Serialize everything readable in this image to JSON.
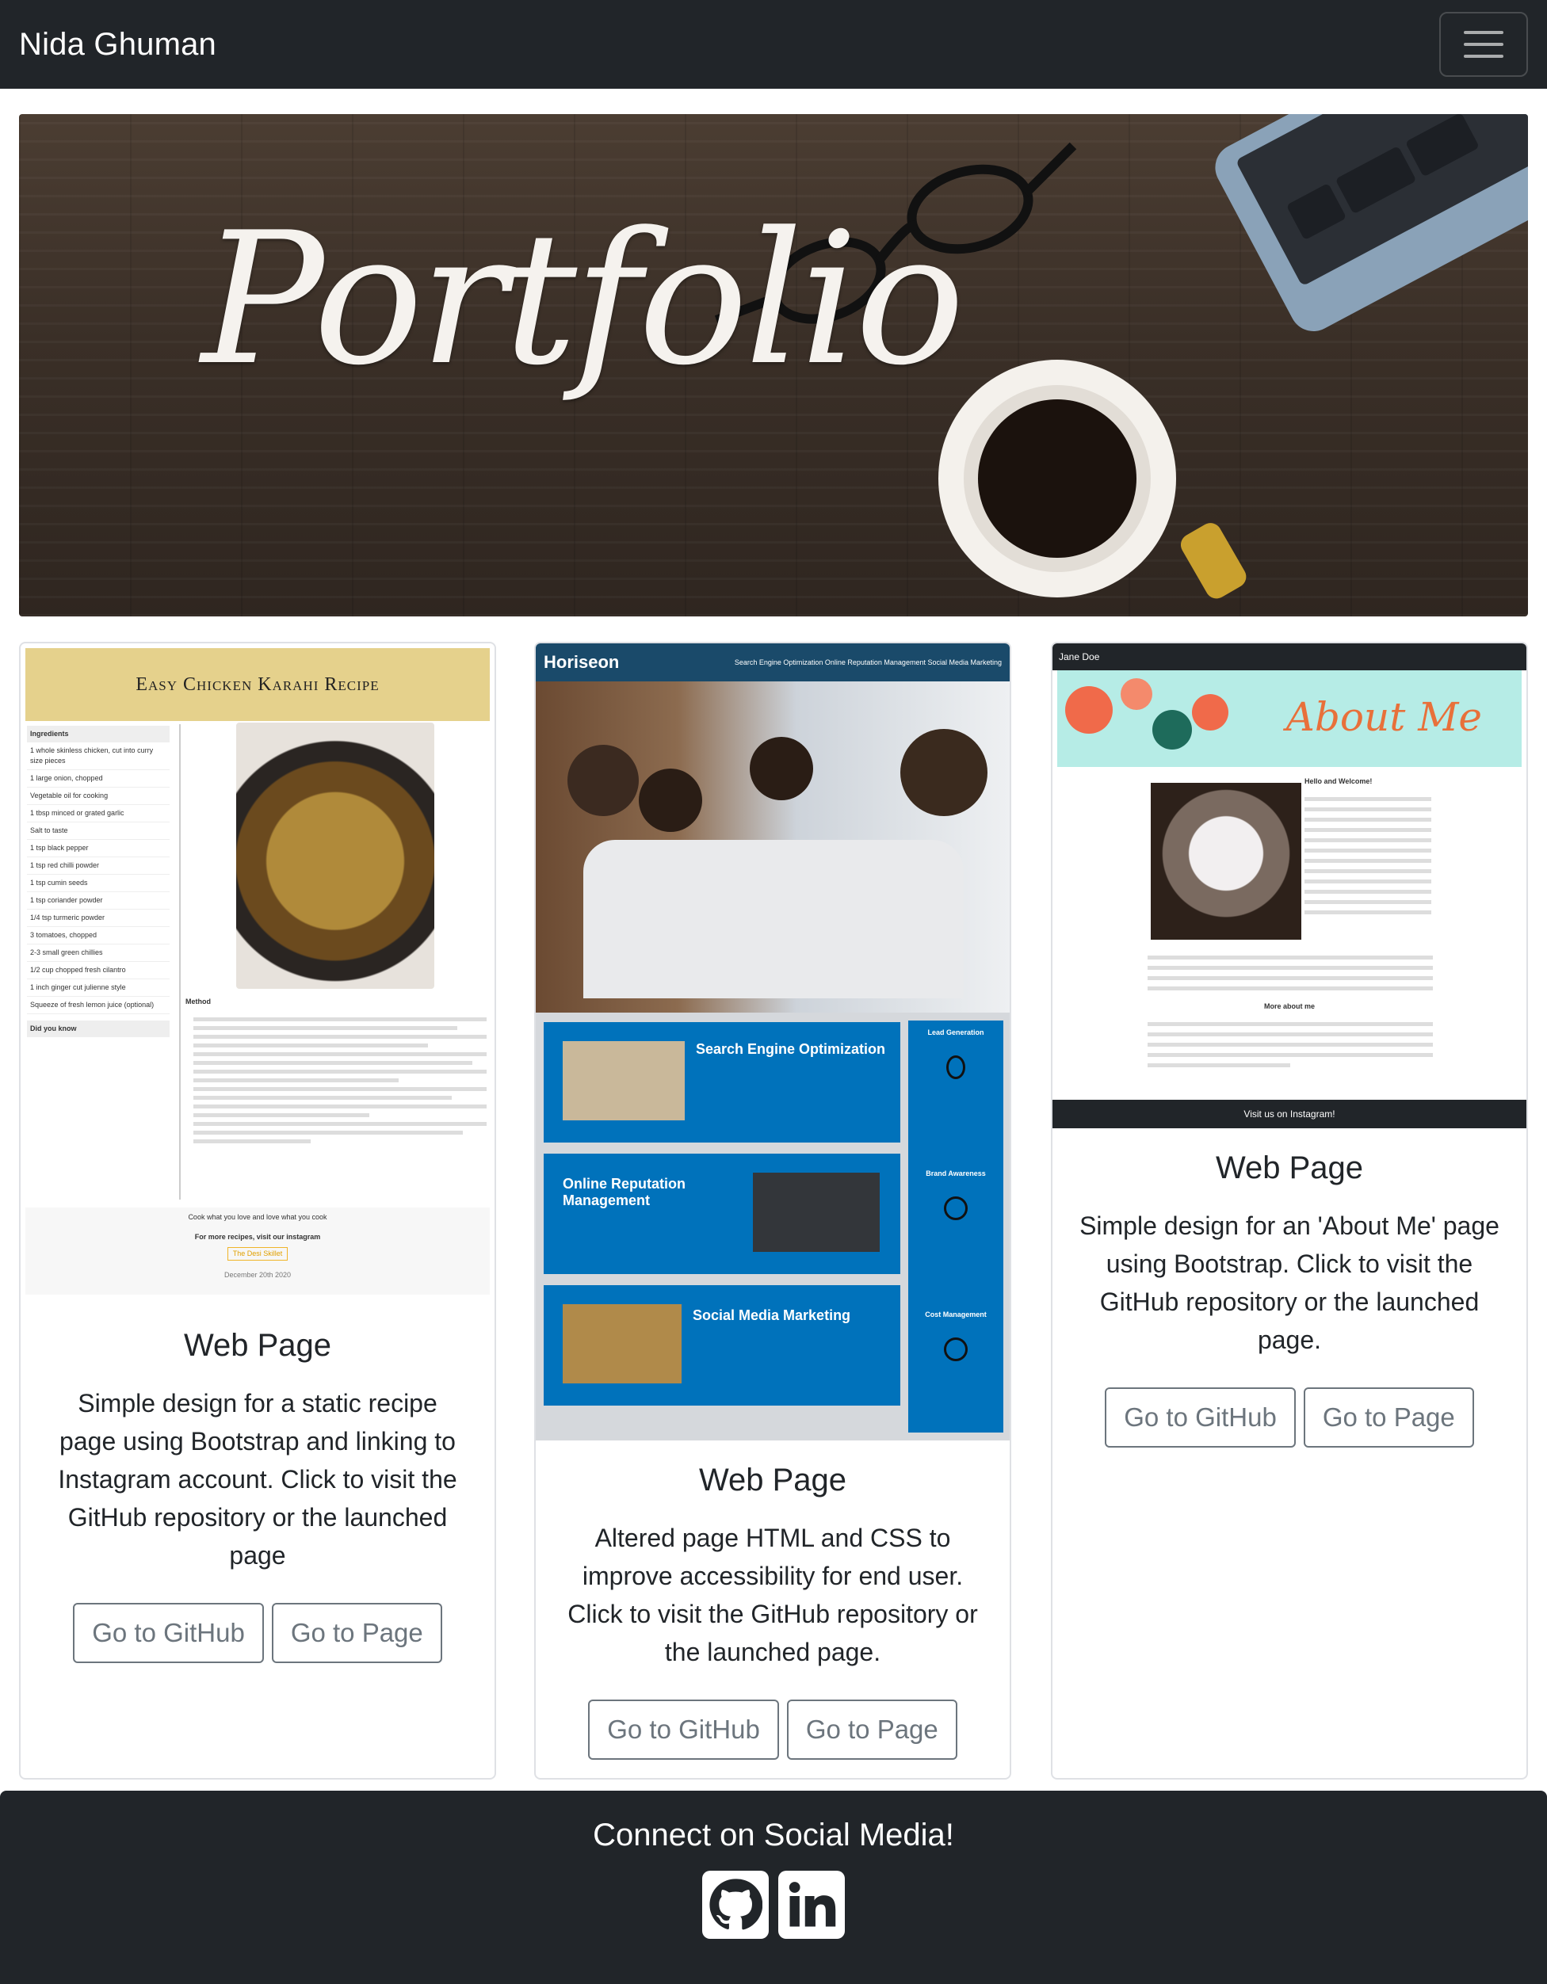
{
  "navbar": {
    "brand": "Nida Ghuman",
    "toggler_icon": "hamburger-menu-icon"
  },
  "hero": {
    "title": "Portfolio"
  },
  "cards": [
    {
      "thumb": {
        "title": "Easy Chicken Karahi Recipe",
        "ingredients_heading": "Ingredients",
        "ingredients": [
          "1 whole skinless chicken, cut into curry size pieces",
          "1 large onion, chopped",
          "Vegetable oil for cooking",
          "1 tbsp minced or grated garlic",
          "Salt to taste",
          "1 tsp black pepper",
          "1 tsp red chilli powder",
          "1 tsp cumin seeds",
          "1 tsp coriander powder",
          "1/4 tsp turmeric powder",
          "3 tomatoes, chopped",
          "2-3 small green chillies",
          "1/2 cup chopped fresh cilantro",
          "1 inch ginger cut julienne style",
          "Squeeze of fresh lemon juice (optional)"
        ],
        "did_you_know": "Did you know",
        "method_heading": "Method",
        "footer_line1": "Cook what you love and love what you cook",
        "footer_line2": "For more recipes, visit our instagram",
        "footer_btn": "The Desi Skillet",
        "date": "December 20th 2020"
      },
      "title": "Web Page",
      "text": "Simple design for a static recipe page using Bootstrap and linking to Instagram account. Click to visit the GitHub repository or the launched page",
      "btn_github": "Go to GitHub",
      "btn_page": "Go to Page"
    },
    {
      "thumb": {
        "brand": "Horiseon",
        "nav": "Search Engine Optimization   Online Reputation Management   Social Media Marketing",
        "row1": "Search Engine Optimization",
        "row2": "Online Reputation Management",
        "row3": "Social Media Marketing",
        "aside1": "Lead Generation",
        "aside2": "Brand Awareness",
        "aside3": "Cost Management"
      },
      "title": "Web Page",
      "text": "Altered page HTML and CSS to improve accessibility for end user. Click to visit the GitHub repository or the launched page.",
      "btn_github": "Go to GitHub",
      "btn_page": "Go to Page"
    },
    {
      "thumb": {
        "brand": "Jane Doe",
        "banner": "About Me",
        "hello": "Hello and Welcome!",
        "more": "More about me",
        "footer": "Visit us on Instagram!"
      },
      "title": "Web Page",
      "text": "Simple design for an 'About Me' page using Bootstrap. Click to visit the GitHub repository or the launched page.",
      "btn_github": "Go to GitHub",
      "btn_page": "Go to Page"
    }
  ],
  "footer": {
    "title": "Connect on Social Media!",
    "icons": [
      "github-icon",
      "linkedin-icon"
    ]
  }
}
